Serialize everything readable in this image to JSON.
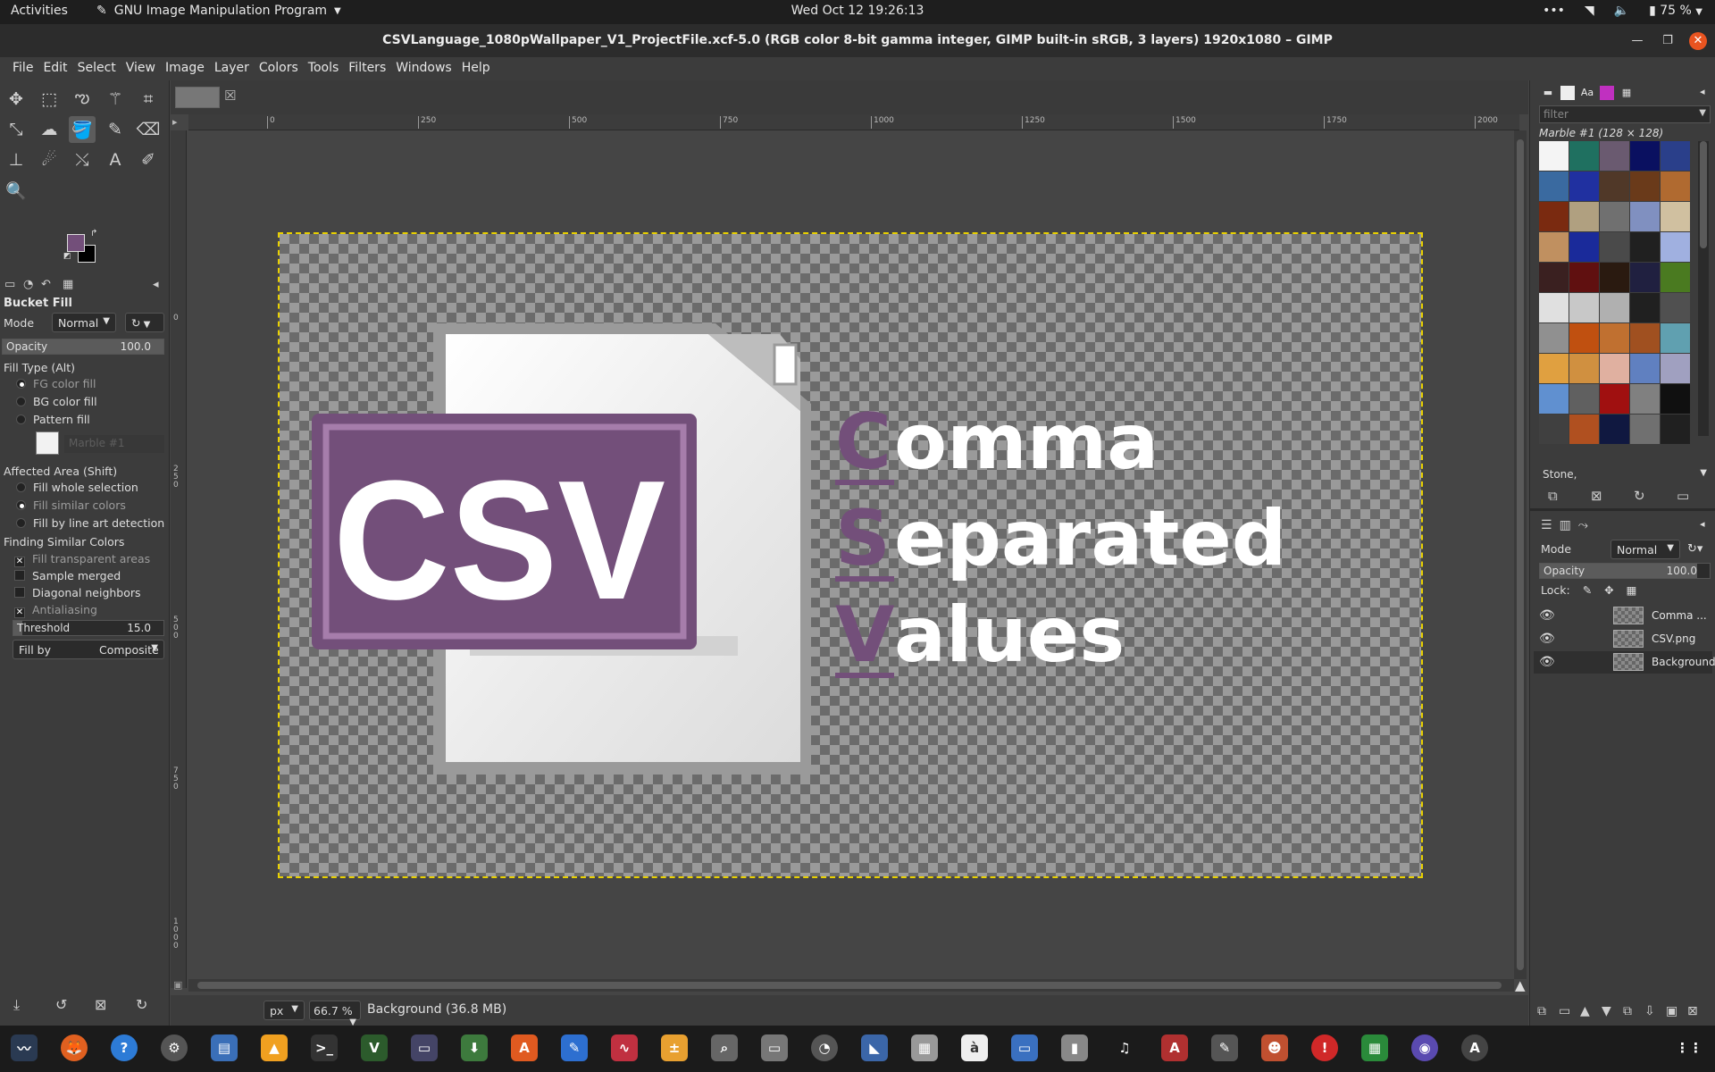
{
  "topbar": {
    "activities": "Activities",
    "app_name": "GNU Image Manipulation Program",
    "clock": "Wed Oct 12  19:26:13",
    "battery": "75 %"
  },
  "window": {
    "title": "CSVLanguage_1080pWallpaper_V1_ProjectFile.xcf-5.0 (RGB color 8-bit gamma integer, GIMP built-in sRGB, 3 layers) 1920x1080 – GIMP"
  },
  "menu": [
    "File",
    "Edit",
    "Select",
    "View",
    "Image",
    "Layer",
    "Colors",
    "Tools",
    "Filters",
    "Windows",
    "Help"
  ],
  "tool_options": {
    "title": "Bucket Fill",
    "mode_label": "Mode",
    "mode_value": "Normal",
    "opacity_label": "Opacity",
    "opacity_value": "100.0",
    "opacity_fraction": 1.0,
    "fill_type_label": "Fill Type  (Alt)",
    "fill_types": [
      "FG color fill",
      "BG color fill",
      "Pattern fill"
    ],
    "selected_fill_type": "FG color fill",
    "pattern_name": "Marble #1",
    "affected_area_label": "Affected Area  (Shift)",
    "affected_areas": [
      "Fill whole selection",
      "Fill similar colors",
      "Fill by line art detection"
    ],
    "selected_area": "Fill similar colors",
    "similar_label": "Finding Similar Colors",
    "checks": [
      {
        "label": "Fill transparent areas",
        "checked": true
      },
      {
        "label": "Sample merged",
        "checked": false
      },
      {
        "label": "Diagonal neighbors",
        "checked": false
      },
      {
        "label": "Antialiasing",
        "checked": true
      }
    ],
    "threshold_label": "Threshold",
    "threshold_value": "15.0",
    "threshold_fraction": 0.06,
    "fillby_label": "Fill by",
    "fillby_value": "Composite",
    "fg_color": "#734f7a",
    "bg_color": "#000000"
  },
  "canvas": {
    "ruler_ticks": [
      "0",
      "250",
      "500",
      "750",
      "1000",
      "1250",
      "1500",
      "1750",
      "2000"
    ],
    "vruler_ticks": [
      "0",
      "250",
      "500",
      "750",
      "1000"
    ],
    "image": {
      "badge": "CSV",
      "word1_initial": "C",
      "word1_rest": "omma",
      "word2_initial": "S",
      "word2_rest": "eparated",
      "word3_initial": "V",
      "word3_rest": "alues",
      "accent": "#734f7a"
    }
  },
  "statusbar": {
    "unit": "px",
    "zoom": "66.7 %",
    "message": "Background (36.8 MB)"
  },
  "patterns": {
    "filter_placeholder": "filter",
    "current": "Marble #1 (128 × 128)",
    "tag": "Stone,"
  },
  "layers": {
    "mode_label": "Mode",
    "mode_value": "Normal",
    "opacity_label": "Opacity",
    "opacity_value": "100.0",
    "lock_label": "Lock:",
    "items": [
      {
        "name": "Comma ...",
        "visible": true
      },
      {
        "name": "CSV.png",
        "visible": true
      },
      {
        "name": "Background",
        "visible": true,
        "selected": true
      }
    ]
  }
}
